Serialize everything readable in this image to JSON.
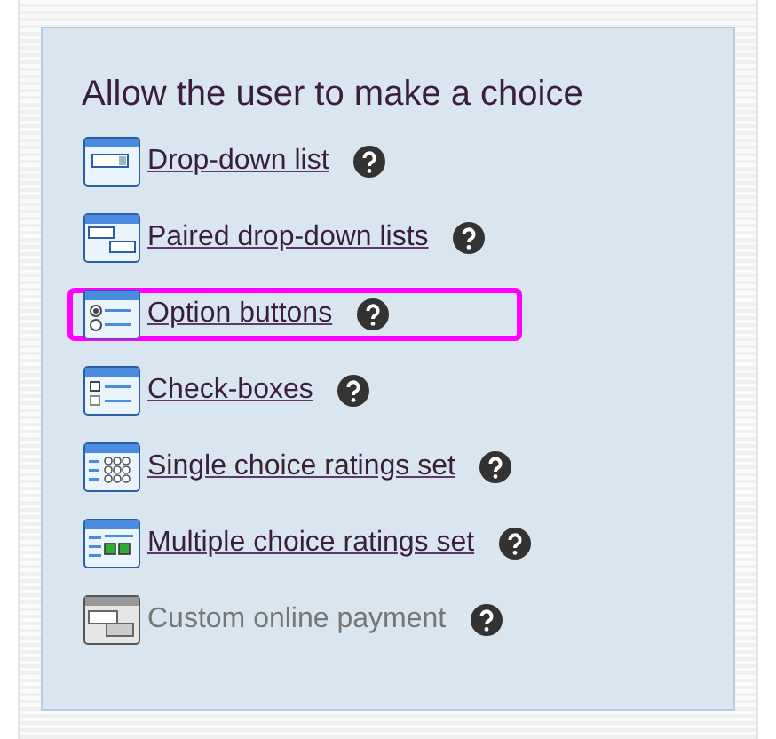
{
  "panel": {
    "title": "Allow the user to make a choice",
    "items": [
      {
        "label": "Drop-down list",
        "kind": "dropdown",
        "disabled": false,
        "selected": false
      },
      {
        "label": "Paired drop-down lists",
        "kind": "paired",
        "disabled": false,
        "selected": false
      },
      {
        "label": "Option buttons",
        "kind": "radio",
        "disabled": false,
        "selected": true
      },
      {
        "label": "Check-boxes",
        "kind": "checkbox",
        "disabled": false,
        "selected": false
      },
      {
        "label": "Single choice ratings set",
        "kind": "single-grid",
        "disabled": false,
        "selected": false
      },
      {
        "label": "Multiple choice ratings set",
        "kind": "multi-grid",
        "disabled": false,
        "selected": false
      },
      {
        "label": "Custom online payment",
        "kind": "payment",
        "disabled": true,
        "selected": false
      }
    ]
  }
}
